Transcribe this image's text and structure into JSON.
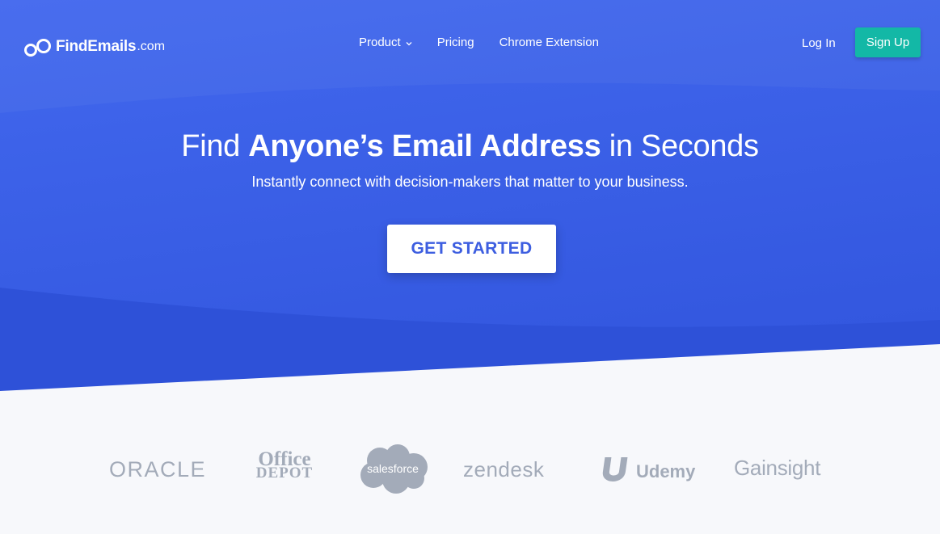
{
  "brand": {
    "name": "FindEmails",
    "tld": ".com"
  },
  "nav": {
    "items": [
      {
        "label": "Product",
        "has_dropdown": true
      },
      {
        "label": "Pricing"
      },
      {
        "label": "Chrome Extension"
      }
    ],
    "login": "Log In",
    "signup": "Sign Up"
  },
  "hero": {
    "title_pre": "Find ",
    "title_bold": "Anyone’s Email Address",
    "title_post": " in Seconds",
    "subtitle": "Instantly connect with decision-makers that matter to your business.",
    "cta": "GET STARTED"
  },
  "clients": {
    "oracle": "ORACLE",
    "office_line1": "Office",
    "office_line2": "DEPOT",
    "salesforce": "salesforce",
    "zendesk": "zendesk",
    "udemy": "Udemy",
    "gainsight": "Gainsight"
  },
  "colors": {
    "hero_top": "#4064ec",
    "hero_bottom": "#3356de",
    "hero_wave": "#2d4fd6",
    "signup_bg": "#13b8a6",
    "cta_text": "#3d5ee0",
    "logo_gray": "#a3abb9",
    "page_bg": "#f7f8fb"
  }
}
